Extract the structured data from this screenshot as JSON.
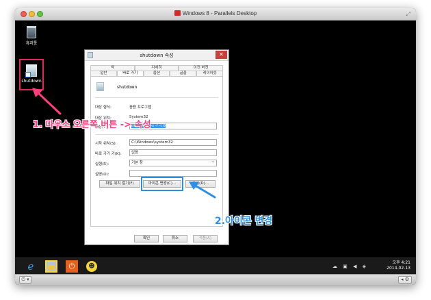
{
  "mac": {
    "title": "Windows 8 - Parallels Desktop"
  },
  "desktop": {
    "recycle_bin_label": "휴지통",
    "shortcut_label": "shutdown"
  },
  "dialog": {
    "title": "shutdown 속성",
    "close_glyph": "✕",
    "tabs_row1": [
      "색",
      "자세히",
      "이전 버전"
    ],
    "tabs_row2": [
      "일반",
      "바로 가기",
      "옵션",
      "글꼴",
      "레이아웃"
    ],
    "shortcut_name": "shutdown",
    "target_type_label": "대상 형식:",
    "target_type_value": "응용 프로그램",
    "target_location_label": "대상 위치:",
    "target_location_value": "System32",
    "target_label": "대상(T):",
    "target_value": "down.exe -s -f -t 0",
    "start_in_label": "시작 위치(S):",
    "start_in_value": "C:\\Windows\\system32",
    "shortcut_key_label": "바로 가기 키(K):",
    "shortcut_key_value": "없음",
    "run_label": "실행(R):",
    "run_value": "기본 창",
    "comment_label": "설명(O):",
    "comment_value": "",
    "open_location_btn": "파일 위치 열기(F)",
    "change_icon_btn": "아이콘 변경(C)...",
    "advanced_btn": "고급(D)...",
    "ok_btn": "확인",
    "cancel_btn": "취소",
    "apply_btn": "적용(A)"
  },
  "annotations": {
    "step1": "1. 마우스 오른쪽 버튼 -> 속성",
    "step2": "2.아이콘 변경",
    "color1": "#ff3d7f",
    "color2": "#2a8fe8"
  },
  "taskbar": {
    "clock_time": "오후 4:21",
    "clock_date": "2014-02-13"
  },
  "icons": {
    "ie": "e",
    "power": "⏻",
    "smile": "☻",
    "statusbar_left": "⏻ ▾",
    "statusbar_right": "◂ ⚙"
  }
}
